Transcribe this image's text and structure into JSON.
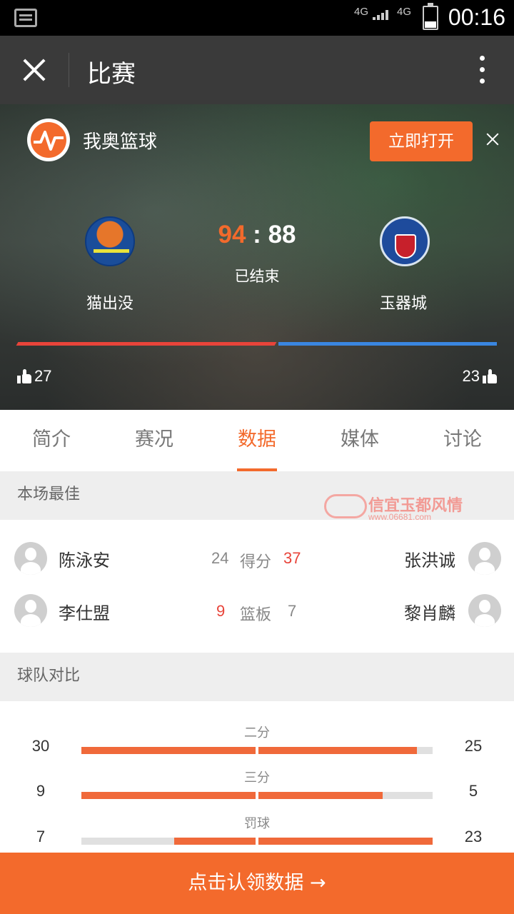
{
  "status_bar": {
    "time": "00:16",
    "network1": "4G",
    "network2": "4G"
  },
  "header": {
    "title": "比赛"
  },
  "banner": {
    "app_name": "我奥篮球",
    "open_label": "立即打开"
  },
  "match": {
    "home": {
      "name": "猫出没",
      "score": "94",
      "likes": "27"
    },
    "away": {
      "name": "玉器城",
      "score": "88",
      "likes": "23"
    },
    "separator": ":",
    "status": "已结束"
  },
  "tabs": [
    {
      "label": "简介"
    },
    {
      "label": "赛况"
    },
    {
      "label": "数据"
    },
    {
      "label": "媒体"
    },
    {
      "label": "讨论"
    }
  ],
  "active_tab": "数据",
  "best": {
    "title": "本场最佳",
    "rows": [
      {
        "home_player": "陈泳安",
        "home_value": "24",
        "label": "得分",
        "away_value": "37",
        "away_player": "张洪诚"
      },
      {
        "home_player": "李仕盟",
        "home_value": "9",
        "label": "篮板",
        "away_value": "7",
        "away_player": "黎肖麟"
      }
    ]
  },
  "watermark": {
    "line1": "信宜玉都风情",
    "line2": "www.06681.com"
  },
  "compare": {
    "title": "球队对比",
    "rows": [
      {
        "label": "二分",
        "home": 30,
        "away": 25
      },
      {
        "label": "三分",
        "home": 9,
        "away": 5
      },
      {
        "label": "罚球",
        "home": 7,
        "away": 23
      }
    ]
  },
  "cta": {
    "label": "点击认领数据 →"
  },
  "colors": {
    "accent": "#f36a2c",
    "home_bar": "#e8443a",
    "away_bar": "#3a86e0",
    "compare_fill": "#f0693a"
  }
}
